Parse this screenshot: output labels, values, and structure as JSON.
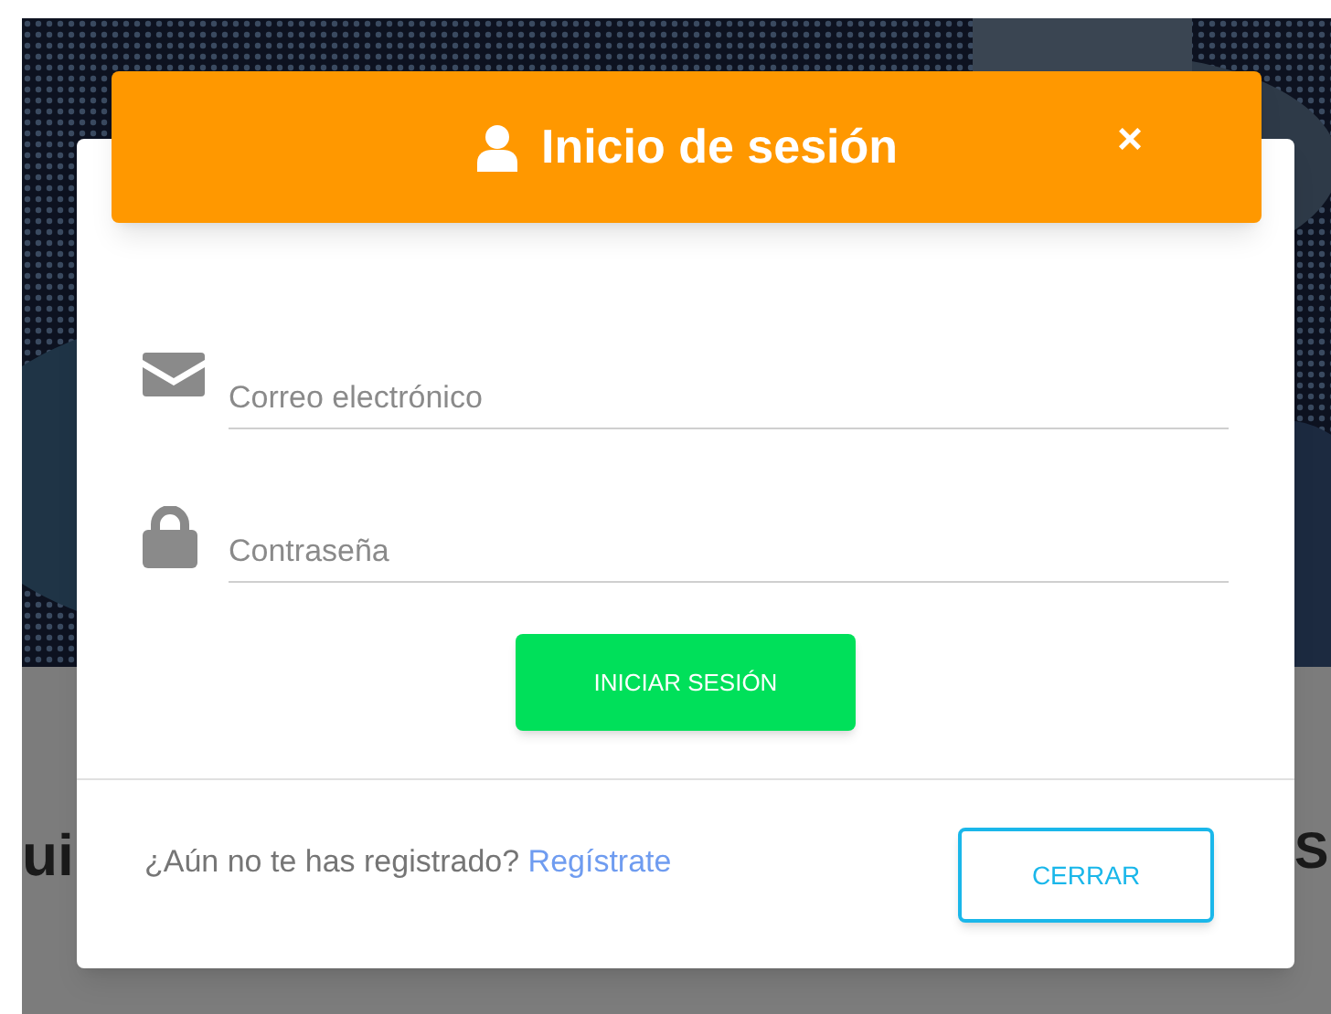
{
  "page": {
    "heading_fragments": [
      "ui",
      "S"
    ]
  },
  "modal": {
    "title": "Inicio de sesión",
    "close_symbol": "×",
    "fields": [
      {
        "kind": "email",
        "placeholder": "Correo electrónico"
      },
      {
        "kind": "password",
        "placeholder": "Contraseña"
      }
    ],
    "submit": "INICIAR SESIÓN",
    "footer_text": "¿Aún no te has registrado?",
    "register_link": "Regístrate",
    "close_button": "CERRAR"
  }
}
